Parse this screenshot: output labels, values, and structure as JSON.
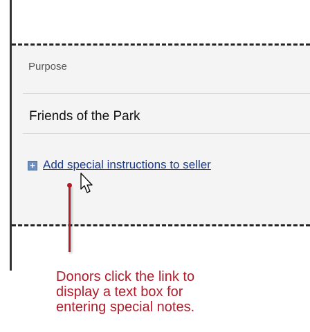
{
  "form": {
    "purpose_label": "Purpose",
    "purpose_value": "Friends of the Park",
    "expand_icon": "plus-box-icon",
    "expand_symbol": "+",
    "add_instructions_link": "Add special instructions to seller"
  },
  "callout": {
    "lines": [
      "Donors click the link to",
      "display a text box for",
      "entering special notes."
    ],
    "color": "#b01c2a"
  },
  "colors": {
    "link": "#1a3a8a",
    "panel_background": "#f4f4f4",
    "icon": "#6e8fbf"
  }
}
